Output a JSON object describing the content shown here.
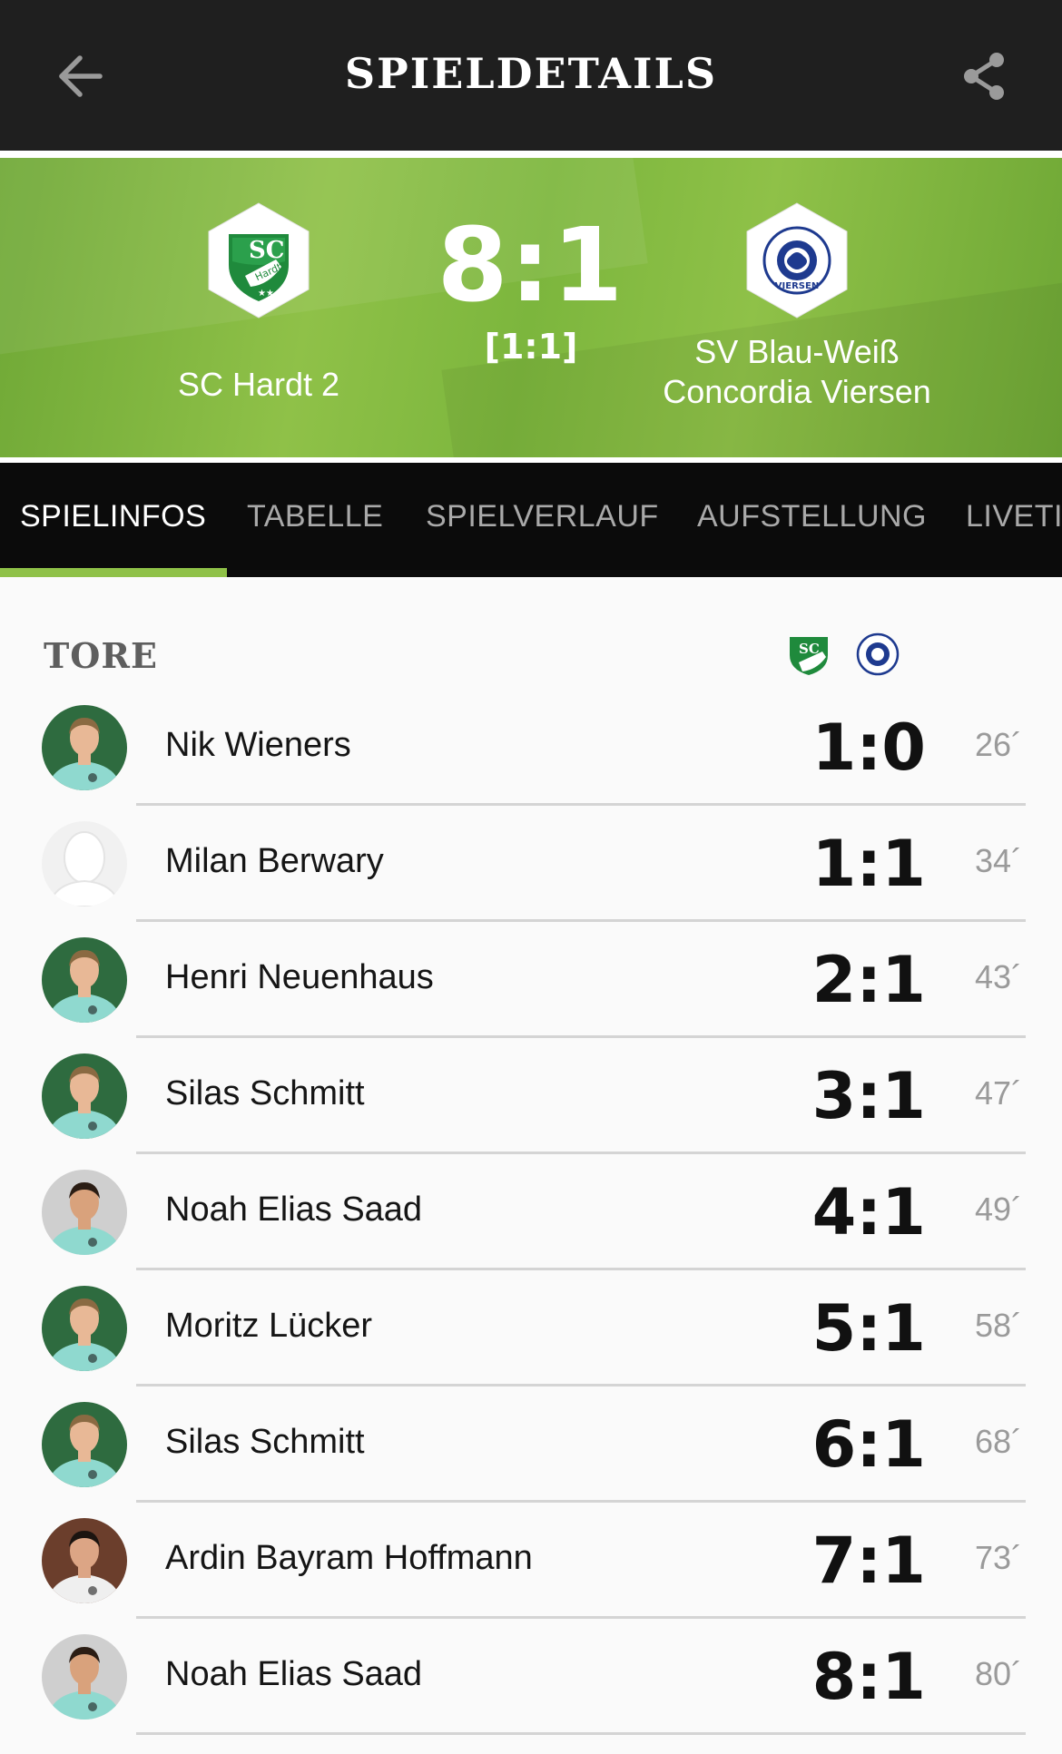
{
  "header": {
    "title": "SPIELDETAILS",
    "back_icon": "arrow-left-icon",
    "share_icon": "share-icon"
  },
  "match": {
    "home_team": "SC Hardt 2",
    "away_team_line1": "SV Blau-Weiß",
    "away_team_line2": "Concordia Viersen",
    "score": "8:1",
    "halftime": "[1:1]",
    "home_crest_text": "SC",
    "home_crest_subtext": "Hardt",
    "away_crest_text": "VIERSEN"
  },
  "tabs": [
    {
      "label": "SPIELINFOS",
      "active": true
    },
    {
      "label": "TABELLE",
      "active": false
    },
    {
      "label": "SPIELVERLAUF",
      "active": false
    },
    {
      "label": "AUFSTELLUNG",
      "active": false
    },
    {
      "label": "LIVETI",
      "active": false
    }
  ],
  "goals_section": {
    "title": "TORE",
    "goals": [
      {
        "player": "Nik Wieners",
        "score": "1:0",
        "minute": "26´",
        "avatar": "player"
      },
      {
        "player": "Milan Berwary",
        "score": "1:1",
        "minute": "34´",
        "avatar": "placeholder"
      },
      {
        "player": "Henri Neuenhaus",
        "score": "2:1",
        "minute": "43´",
        "avatar": "player"
      },
      {
        "player": "Silas Schmitt",
        "score": "3:1",
        "minute": "47´",
        "avatar": "player"
      },
      {
        "player": "Noah Elias Saad",
        "score": "4:1",
        "minute": "49´",
        "avatar": "player-dark"
      },
      {
        "player": "Moritz Lücker",
        "score": "5:1",
        "minute": "58´",
        "avatar": "player"
      },
      {
        "player": "Silas Schmitt",
        "score": "6:1",
        "minute": "68´",
        "avatar": "player"
      },
      {
        "player": "Ardin Bayram Hoffmann",
        "score": "7:1",
        "minute": "73´",
        "avatar": "player-white"
      },
      {
        "player": "Noah Elias Saad",
        "score": "8:1",
        "minute": "80´",
        "avatar": "player-dark"
      }
    ]
  },
  "colors": {
    "accent_green": "#8fc148",
    "topbar": "#1f1f1f",
    "tabs_bg": "#0b0b0b",
    "jersey": "#8fd9cf"
  }
}
